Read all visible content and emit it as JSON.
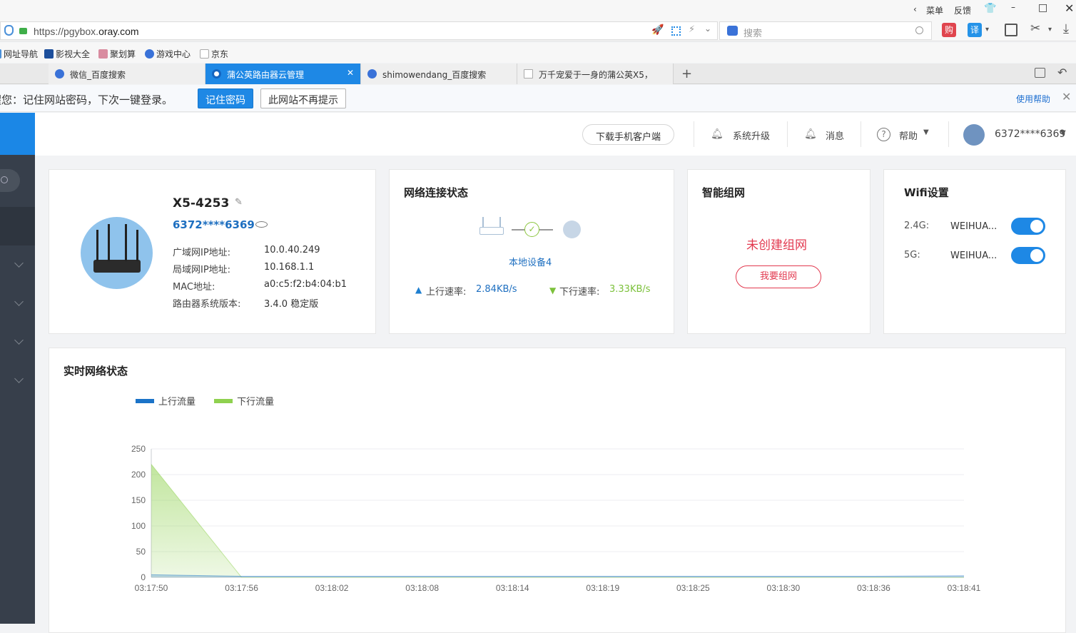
{
  "browser": {
    "menu_label": "菜单",
    "feedback_label": "反馈",
    "url_prefix": "https://pgybox.",
    "url_domain": "oray.com",
    "search_placeholder": "搜索",
    "gou_label": "购",
    "yi_label": "译",
    "bookmarks": [
      "网址导航",
      "影视大全",
      "聚划算",
      "游戏中心",
      "京东"
    ],
    "tabs": [
      "微信_百度搜索",
      "蒲公英路由器云管理",
      "shimowendang_百度搜索",
      "万千宠爱于一身的蒲公英X5，"
    ],
    "password_prompt": "提醒您：记住网站密码，下次一键登录。",
    "remember_btn": "记住密码",
    "never_btn": "此网站不再提示",
    "help_link": "使用帮助"
  },
  "topnav": {
    "download": "下载手机客户端",
    "upgrade": "系统升级",
    "messages": "消息",
    "help": "帮助",
    "account": "6372****6369"
  },
  "device": {
    "name": "X5-4253",
    "sn": "6372****6369",
    "wan_label": "广域网IP地址:",
    "wan_value": "10.0.40.249",
    "lan_label": "局域网IP地址:",
    "lan_value": "10.168.1.1",
    "mac_label": "MAC地址:",
    "mac_value": "a0:c5:f2:b4:04:b1",
    "ver_label": "路由器系统版本:",
    "ver_value": "3.4.0 稳定版"
  },
  "network": {
    "title": "网络连接状态",
    "local_devices": "本地设备4",
    "up_label": "上行速率:",
    "up_value": "2.84KB/s",
    "down_label": "下行速率:",
    "down_value": "3.33KB/s",
    "up_color": "#1e7fd0",
    "down_color": "#7cc13b"
  },
  "mesh": {
    "title": "智能组网",
    "status": "未创建组网",
    "button": "我要组网",
    "color": "#e2394f"
  },
  "wifi": {
    "title": "Wifi设置",
    "bands": [
      {
        "band": "2.4G:",
        "ssid": "WEIHUA...",
        "enabled": true
      },
      {
        "band": "5G:",
        "ssid": "WEIHUA...",
        "enabled": true
      }
    ]
  },
  "realtime": {
    "title": "实时网络状态"
  },
  "chart_data": {
    "type": "area",
    "x": [
      "03:17:50",
      "03:17:56",
      "03:18:02",
      "03:18:08",
      "03:18:14",
      "03:18:19",
      "03:18:25",
      "03:18:30",
      "03:18:36",
      "03:18:41"
    ],
    "yticks": [
      0,
      50,
      100,
      150,
      200,
      250
    ],
    "ylim": [
      0,
      250
    ],
    "grid": true,
    "legend_position": "top-left",
    "series": [
      {
        "name": "上行流量",
        "color": "#1b73c8",
        "values": [
          5,
          2,
          2,
          2,
          2,
          2,
          2,
          2,
          2,
          3
        ]
      },
      {
        "name": "下行流量",
        "color": "#8fd14f",
        "values": [
          220,
          0,
          0,
          0,
          0,
          0,
          0,
          0,
          0,
          0
        ]
      }
    ]
  }
}
